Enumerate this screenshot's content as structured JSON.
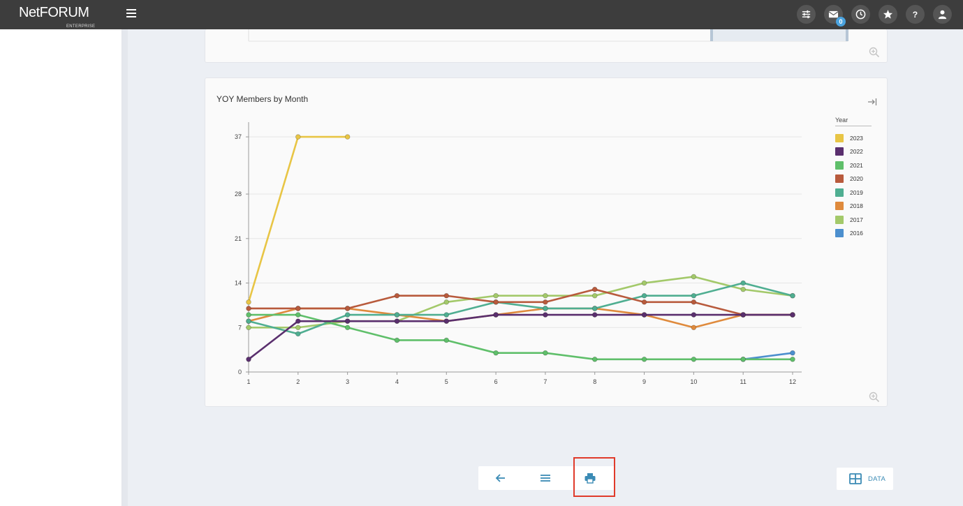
{
  "header": {
    "logo_text": "NetFORUM",
    "logo_sub": "ENTERPRISE",
    "mail_count": "0"
  },
  "icons": [
    "settings-sliders-icon",
    "mail-icon",
    "clock-icon",
    "star-icon",
    "help-icon",
    "user-icon"
  ],
  "chart_card": {
    "title": "YOY Members by Month"
  },
  "chart_data": {
    "type": "line",
    "title": "YOY Members by Month",
    "xlabel": "",
    "ylabel": "",
    "x": [
      1,
      2,
      3,
      4,
      5,
      6,
      7,
      8,
      9,
      10,
      11,
      12
    ],
    "y_ticks": [
      0,
      7,
      14,
      21,
      28,
      37
    ],
    "ylim": [
      0,
      38
    ],
    "xlim": [
      1,
      12
    ],
    "grid": true,
    "legend_title": "Year",
    "legend_position": "right",
    "series": [
      {
        "name": "2023",
        "color": "#e8c545",
        "values": [
          11,
          37,
          37,
          null,
          null,
          null,
          null,
          null,
          null,
          null,
          null,
          null
        ]
      },
      {
        "name": "2022",
        "color": "#5a2f6e",
        "values": [
          2,
          8,
          8,
          8,
          8,
          9,
          9,
          9,
          9,
          9,
          9,
          9
        ]
      },
      {
        "name": "2021",
        "color": "#5fbf6a",
        "values": [
          9,
          9,
          7,
          5,
          5,
          3,
          3,
          2,
          2,
          2,
          2,
          2
        ]
      },
      {
        "name": "2020",
        "color": "#b85a3c",
        "values": [
          10,
          10,
          10,
          12,
          12,
          11,
          11,
          13,
          11,
          11,
          9,
          9
        ]
      },
      {
        "name": "2019",
        "color": "#4fae91",
        "values": [
          8,
          6,
          9,
          9,
          9,
          11,
          10,
          10,
          12,
          12,
          14,
          12
        ]
      },
      {
        "name": "2018",
        "color": "#df8a3c",
        "values": [
          8,
          10,
          10,
          9,
          8,
          9,
          10,
          10,
          9,
          7,
          9,
          9
        ]
      },
      {
        "name": "2017",
        "color": "#a3c96a",
        "values": [
          7,
          7,
          8,
          8,
          11,
          12,
          12,
          12,
          14,
          15,
          13,
          12
        ]
      },
      {
        "name": "2016",
        "color": "#4c8fce",
        "values": [
          null,
          null,
          null,
          null,
          null,
          null,
          null,
          null,
          null,
          null,
          2,
          3
        ]
      }
    ]
  },
  "bottom_toolbar": {
    "data_label": "DATA"
  }
}
